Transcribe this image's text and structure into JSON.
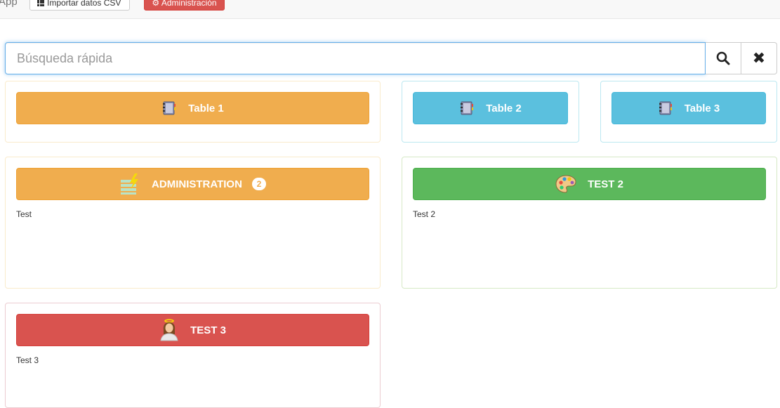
{
  "topbar": {
    "brand": "App",
    "import_csv_label": "Importar datos CSV",
    "admin_label": "⚙ Administración"
  },
  "search": {
    "placeholder": "Búsqueda rápida",
    "value": ""
  },
  "cards": {
    "table1": {
      "label": "Table 1"
    },
    "table2": {
      "label": "Table 2"
    },
    "table3": {
      "label": "Table 3"
    },
    "administration": {
      "label": "ADMINISTRATION",
      "badge": "2",
      "description": "Test"
    },
    "test2": {
      "label": "TEST 2",
      "description": "Test 2"
    },
    "test3": {
      "label": "TEST 3",
      "description": "Test 3"
    }
  },
  "colors": {
    "warning": "#f0ad4e",
    "info": "#5bc0de",
    "success": "#5cb85c",
    "danger": "#d9534f"
  },
  "icons": [
    "grid-icon",
    "search-icon",
    "close-icon",
    "notebook-icon",
    "stack-lightning-icon",
    "palette-icon",
    "person-icon"
  ]
}
